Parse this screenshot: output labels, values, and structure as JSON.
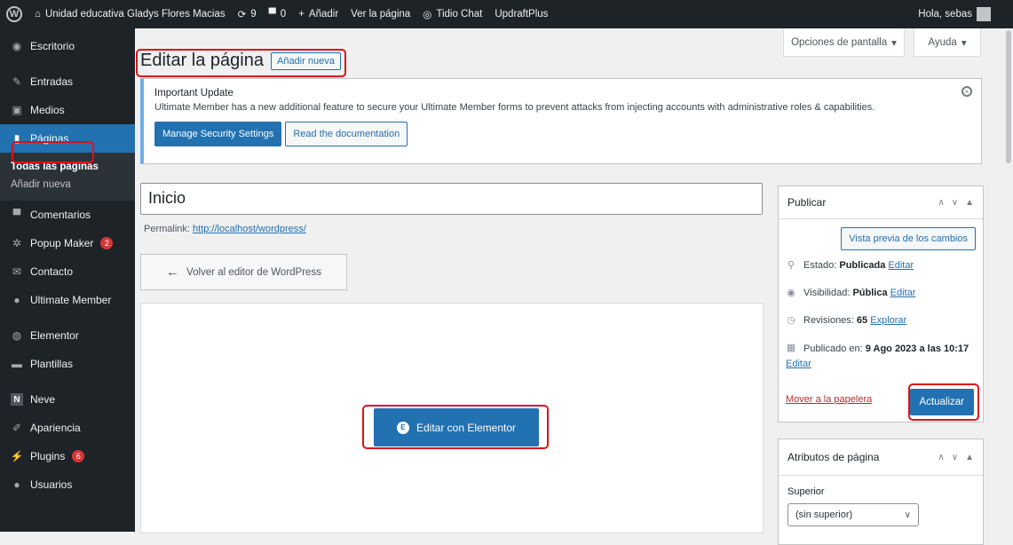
{
  "adminbar": {
    "site_name": "Unidad educativa Gladys Flores Macias",
    "updates": "9",
    "comments": "0",
    "add_new": "Añadir",
    "view_page": "Ver la página",
    "tidio": "Tidio Chat",
    "updraft": "UpdraftPlus",
    "greeting": "Hola, sebas"
  },
  "sidebar": {
    "items": [
      {
        "label": "Escritorio",
        "icon": "dashboard-icon"
      },
      {
        "label": "Entradas",
        "icon": "pin-icon"
      },
      {
        "label": "Medios",
        "icon": "media-icon"
      },
      {
        "label": "Páginas",
        "icon": "page-icon"
      },
      {
        "label": "Comentarios",
        "icon": "comment-icon"
      },
      {
        "label": "Popup Maker",
        "icon": "popup-icon",
        "badge": "2"
      },
      {
        "label": "Contacto",
        "icon": "mail-icon"
      },
      {
        "label": "Ultimate Member",
        "icon": "user-icon"
      },
      {
        "label": "Elementor",
        "icon": "elementor-icon"
      },
      {
        "label": "Plantillas",
        "icon": "folder-icon"
      },
      {
        "label": "Neve",
        "icon": "neve-icon"
      },
      {
        "label": "Apariencia",
        "icon": "brush-icon"
      },
      {
        "label": "Plugins",
        "icon": "plugin-icon",
        "badge": "6"
      },
      {
        "label": "Usuarios",
        "icon": "users-icon"
      }
    ],
    "submenu": [
      "Todas las páginas",
      "Añadir nueva"
    ]
  },
  "header": {
    "screen_options": "Opciones de pantalla",
    "help": "Ayuda",
    "title": "Editar la página",
    "add_new": "Añadir nueva"
  },
  "notice": {
    "title": "Important Update",
    "text": "Ultimate Member has a new additional feature to secure your Ultimate Member forms to prevent attacks from injecting accounts with administrative roles & capabilities.",
    "primary_btn": "Manage Security Settings",
    "secondary_btn": "Read the documentation"
  },
  "editor": {
    "title_value": "Inicio",
    "permalink_label": "Permalink:",
    "permalink_url": "http://localhost/wordpress/",
    "back_btn": "Volver al editor de WordPress",
    "elementor_btn": "Editar con Elementor"
  },
  "publish": {
    "title": "Publicar",
    "preview": "Vista previa de los cambios",
    "status_label": "Estado:",
    "status_value": "Publicada",
    "visibility_label": "Visibilidad:",
    "visibility_value": "Pública",
    "revisions_label": "Revisiones:",
    "revisions_value": "65",
    "explore": "Explorar",
    "published_label": "Publicado en:",
    "published_value": "9 Ago 2023 a las 10:17",
    "edit": "Editar",
    "trash": "Mover a la papelera",
    "update": "Actualizar"
  },
  "attributes": {
    "title": "Atributos de página",
    "parent_label": "Superior",
    "parent_value": "(sin superior)"
  },
  "colors": {
    "admin_dark": "#1d2327",
    "accent": "#2271b1",
    "highlight_box": "#e0101a"
  }
}
